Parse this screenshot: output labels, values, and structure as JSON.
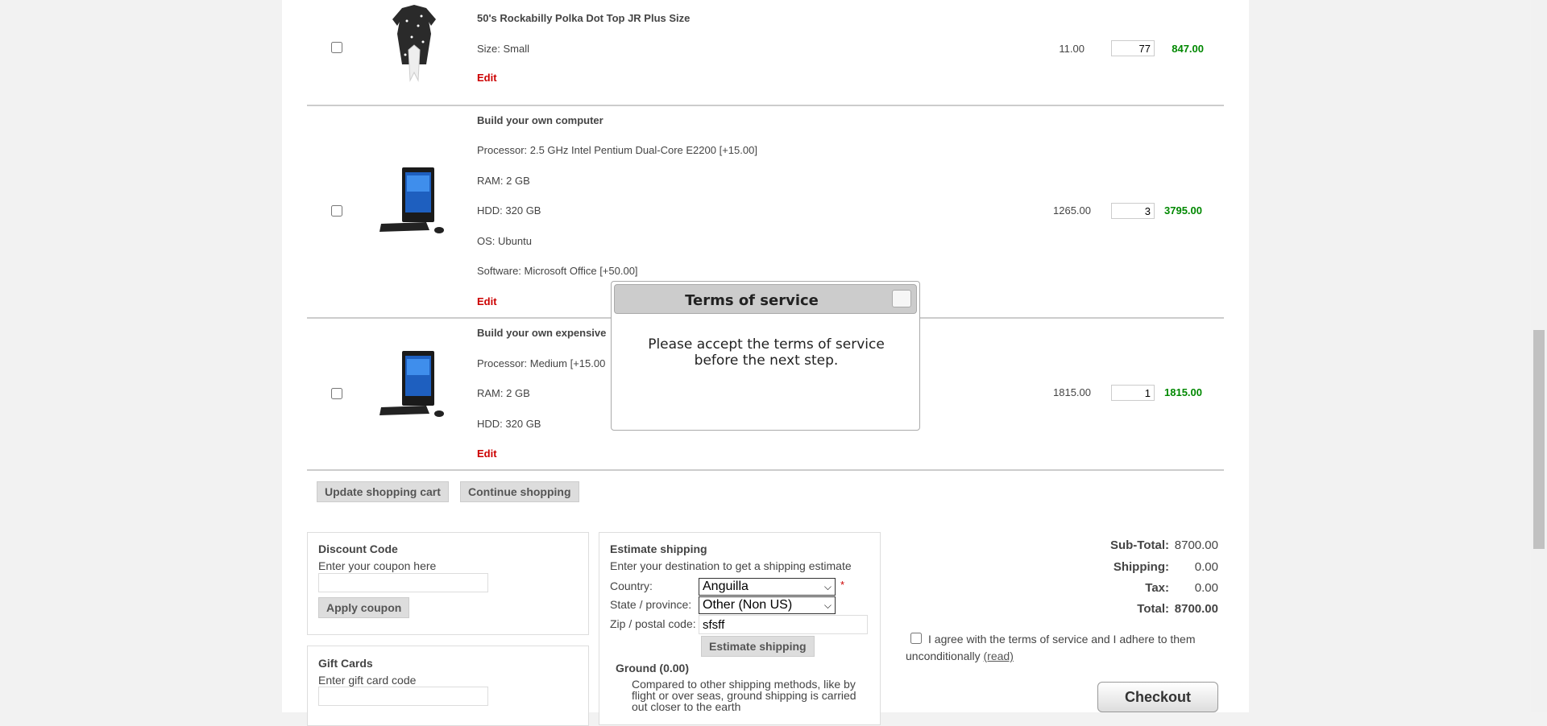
{
  "cart": {
    "items": [
      {
        "name": "50's Rockabilly Polka Dot Top JR Plus Size",
        "attributes": [
          "Size: Small"
        ],
        "edit_label": "Edit",
        "unit_price": "11.00",
        "quantity": "77",
        "subtotal": "847.00",
        "image_icon": "polka-dot-top-image"
      },
      {
        "name": "Build your own computer",
        "attributes": [
          "Processor: 2.5 GHz Intel Pentium Dual-Core E2200 [+15.00]",
          "RAM: 2 GB",
          "HDD: 320 GB",
          "OS: Ubuntu",
          "Software: Microsoft Office [+50.00]"
        ],
        "edit_label": "Edit",
        "unit_price": "1265.00",
        "quantity": "3",
        "subtotal": "3795.00",
        "image_icon": "desktop-computer-image"
      },
      {
        "name": "Build your own expensive",
        "attributes": [
          "Processor: Medium [+15.00",
          "RAM: 2 GB",
          "HDD: 320 GB"
        ],
        "edit_label": "Edit",
        "unit_price": "1815.00",
        "quantity": "1",
        "subtotal": "1815.00",
        "image_icon": "desktop-computer-image"
      }
    ],
    "update_label": "Update shopping cart",
    "continue_label": "Continue shopping"
  },
  "discount": {
    "title": "Discount Code",
    "hint": "Enter your coupon here",
    "value": "",
    "button": "Apply coupon"
  },
  "giftcards": {
    "title": "Gift Cards",
    "hint": "Enter gift card code",
    "value": ""
  },
  "shipping": {
    "title": "Estimate shipping",
    "hint": "Enter your destination to get a shipping estimate",
    "country_label": "Country:",
    "country_value": "Anguilla",
    "required_mark": "*",
    "state_label": "State / province:",
    "state_value": "Other (Non US)",
    "zip_label": "Zip / postal code:",
    "zip_value": "sfsff",
    "button": "Estimate shipping",
    "option_name": "Ground (0.00)",
    "option_desc": "Compared to other shipping methods, like by flight or over seas, ground shipping is carried out closer to the earth"
  },
  "totals": {
    "subtotal_label": "Sub-Total:",
    "subtotal_value": "8700.00",
    "shipping_label": "Shipping:",
    "shipping_value": "0.00",
    "tax_label": "Tax:",
    "tax_value": "0.00",
    "total_label": "Total:",
    "total_value": "8700.00"
  },
  "terms": {
    "agree_text": "I agree with the terms of service and I adhere to them unconditionally",
    "read_link": "(read)",
    "checkout": "Checkout"
  },
  "modal": {
    "title": "Terms of service",
    "message": "Please accept the terms of service before the next step."
  }
}
